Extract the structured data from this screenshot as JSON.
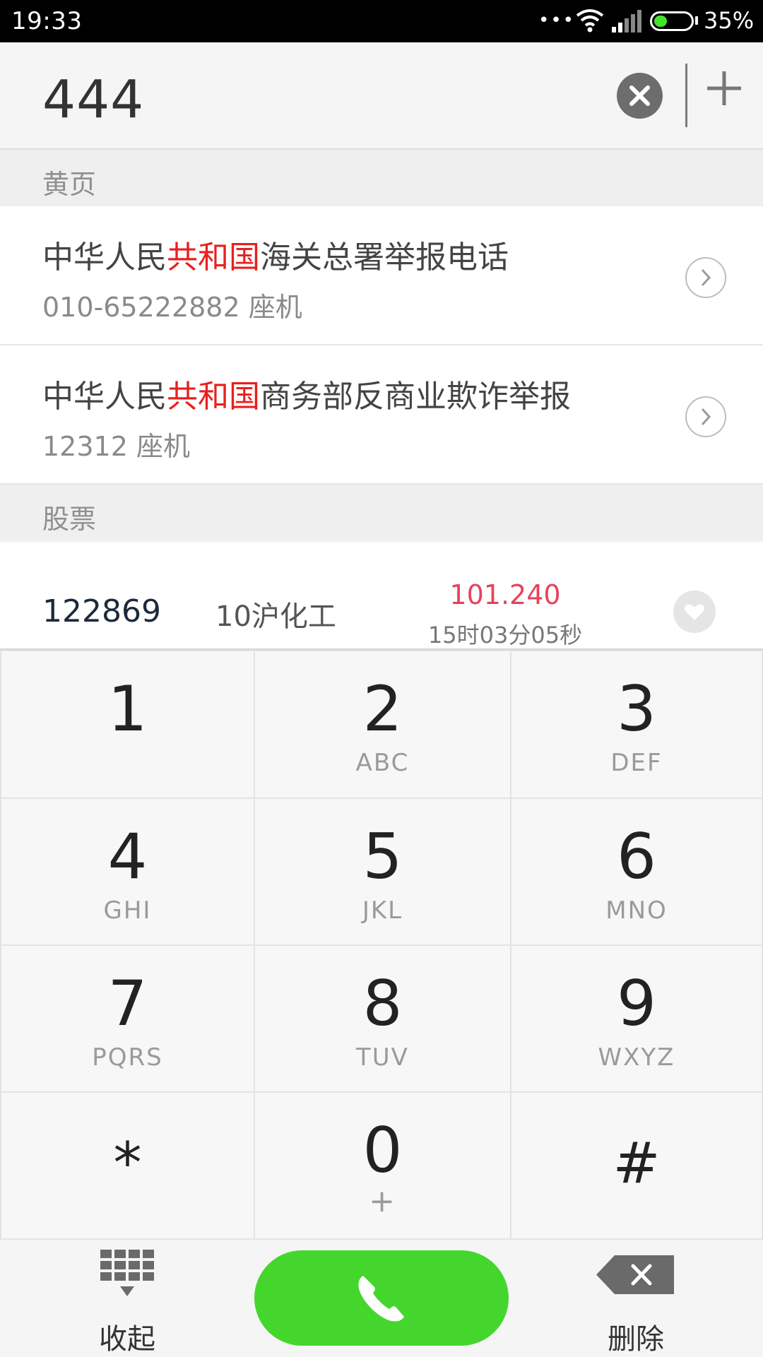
{
  "status_bar": {
    "time": "19:33",
    "battery_percent": "35%",
    "battery_level": 0.35,
    "dots": "•••"
  },
  "header": {
    "dialed_number": "444"
  },
  "sections": {
    "yellow_pages": "黄页",
    "stocks": "股票"
  },
  "listings": [
    {
      "title_prefix": "中华人民",
      "title_highlight": "共和国",
      "title_suffix": "海关总署举报电话",
      "subtitle": "010-65222882 座机"
    },
    {
      "title_prefix": "中华人民",
      "title_highlight": "共和国",
      "title_suffix": "商务部反商业欺诈举报",
      "subtitle": "12312 座机"
    }
  ],
  "stock": {
    "code": "122869",
    "name": "10沪化工",
    "price": "101.240",
    "time": "15时03分05秒"
  },
  "keypad": {
    "keys": [
      {
        "digit": "1",
        "letters": ""
      },
      {
        "digit": "2",
        "letters": "ABC"
      },
      {
        "digit": "3",
        "letters": "DEF"
      },
      {
        "digit": "4",
        "letters": "GHI"
      },
      {
        "digit": "5",
        "letters": "JKL"
      },
      {
        "digit": "6",
        "letters": "MNO"
      },
      {
        "digit": "7",
        "letters": "PQRS"
      },
      {
        "digit": "8",
        "letters": "TUV"
      },
      {
        "digit": "9",
        "letters": "WXYZ"
      },
      {
        "digit": "*",
        "letters": ""
      },
      {
        "digit": "0",
        "letters": "+"
      },
      {
        "digit": "#",
        "letters": ""
      }
    ]
  },
  "bottom_bar": {
    "collapse_label": "收起",
    "delete_label": "删除"
  },
  "colors": {
    "highlight": "#e8201e",
    "call_green": "#44d62c",
    "price_red": "#e8425a",
    "battery_green": "#45e22d"
  },
  "icons": [
    "wifi-icon",
    "signal-icon",
    "battery-icon",
    "clear-icon",
    "add-icon",
    "chevron-right-icon",
    "heart-icon",
    "dialpad-icon",
    "phone-icon",
    "backspace-icon"
  ]
}
